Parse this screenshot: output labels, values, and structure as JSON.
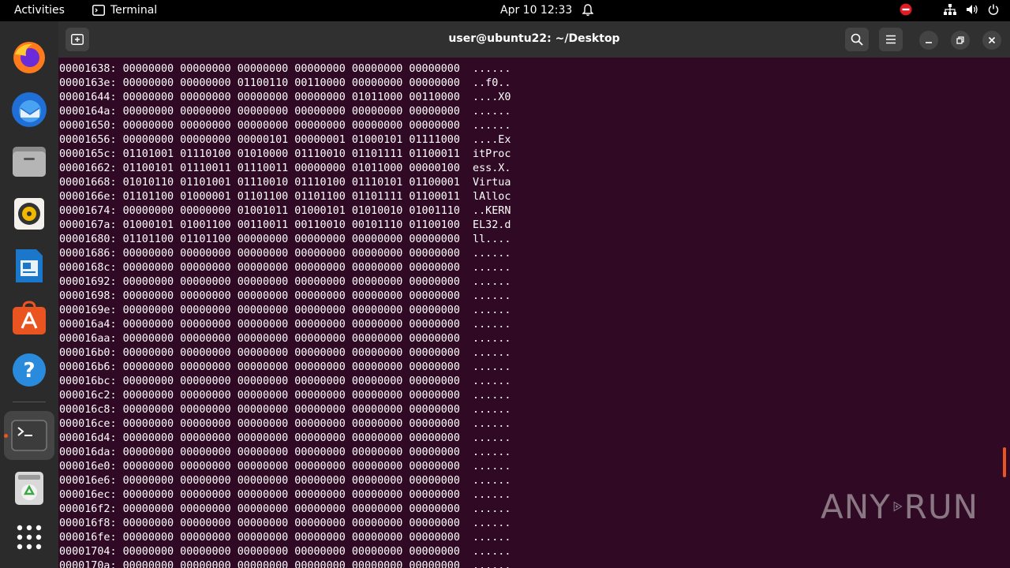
{
  "topbar": {
    "activities": "Activities",
    "app_name": "Terminal",
    "clock": "Apr 10  12:33"
  },
  "dock": {
    "items": [
      {
        "name": "firefox",
        "icon": "firefox-icon"
      },
      {
        "name": "thunderbird",
        "icon": "thunderbird-icon"
      },
      {
        "name": "files",
        "icon": "files-icon"
      },
      {
        "name": "rhythmbox",
        "icon": "rhythmbox-icon"
      },
      {
        "name": "libreoffice-writer",
        "icon": "writer-icon"
      },
      {
        "name": "app-center",
        "icon": "app-center-icon"
      },
      {
        "name": "help",
        "icon": "help-icon"
      },
      {
        "name": "terminal",
        "icon": "terminal-icon",
        "active": true
      },
      {
        "name": "trash",
        "icon": "trash-icon"
      },
      {
        "name": "show-apps",
        "icon": "app-grid-icon"
      }
    ],
    "accent": "#e95420"
  },
  "window": {
    "title": "user@ubuntu22: ~/Desktop",
    "background": "#300a24"
  },
  "terminal": {
    "lines": [
      "00001638: 00000000 00000000 00000000 00000000 00000000 00000000  ......",
      "0000163e: 00000000 00000000 01100110 00110000 00000000 00000000  ..f0..",
      "00001644: 00000000 00000000 00000000 00000000 01011000 00110000  ....X0",
      "0000164a: 00000000 00000000 00000000 00000000 00000000 00000000  ......",
      "00001650: 00000000 00000000 00000000 00000000 00000000 00000000  ......",
      "00001656: 00000000 00000000 00000101 00000001 01000101 01111000  ....Ex",
      "0000165c: 01101001 01110100 01010000 01110010 01101111 01100011  itProc",
      "00001662: 01100101 01110011 01110011 00000000 01011000 00000100  ess.X.",
      "00001668: 01010110 01101001 01110010 01110100 01110101 01100001  Virtua",
      "0000166e: 01101100 01000001 01101100 01101100 01101111 01100011  lAlloc",
      "00001674: 00000000 00000000 01001011 01000101 01010010 01001110  ..KERN",
      "0000167a: 01000101 01001100 00110011 00110010 00101110 01100100  EL32.d",
      "00001680: 01101100 01101100 00000000 00000000 00000000 00000000  ll....",
      "00001686: 00000000 00000000 00000000 00000000 00000000 00000000  ......",
      "0000168c: 00000000 00000000 00000000 00000000 00000000 00000000  ......",
      "00001692: 00000000 00000000 00000000 00000000 00000000 00000000  ......",
      "00001698: 00000000 00000000 00000000 00000000 00000000 00000000  ......",
      "0000169e: 00000000 00000000 00000000 00000000 00000000 00000000  ......",
      "000016a4: 00000000 00000000 00000000 00000000 00000000 00000000  ......",
      "000016aa: 00000000 00000000 00000000 00000000 00000000 00000000  ......",
      "000016b0: 00000000 00000000 00000000 00000000 00000000 00000000  ......",
      "000016b6: 00000000 00000000 00000000 00000000 00000000 00000000  ......",
      "000016bc: 00000000 00000000 00000000 00000000 00000000 00000000  ......",
      "000016c2: 00000000 00000000 00000000 00000000 00000000 00000000  ......",
      "000016c8: 00000000 00000000 00000000 00000000 00000000 00000000  ......",
      "000016ce: 00000000 00000000 00000000 00000000 00000000 00000000  ......",
      "000016d4: 00000000 00000000 00000000 00000000 00000000 00000000  ......",
      "000016da: 00000000 00000000 00000000 00000000 00000000 00000000  ......",
      "000016e0: 00000000 00000000 00000000 00000000 00000000 00000000  ......",
      "000016e6: 00000000 00000000 00000000 00000000 00000000 00000000  ......",
      "000016ec: 00000000 00000000 00000000 00000000 00000000 00000000  ......",
      "000016f2: 00000000 00000000 00000000 00000000 00000000 00000000  ......",
      "000016f8: 00000000 00000000 00000000 00000000 00000000 00000000  ......",
      "000016fe: 00000000 00000000 00000000 00000000 00000000 00000000  ......",
      "00001704: 00000000 00000000 00000000 00000000 00000000 00000000  ......",
      "0000170a: 00000000 00000000 00000000 00000000 00000000 00000000  ......"
    ]
  },
  "watermark": {
    "text_left": "ANY",
    "text_right": "RUN"
  }
}
